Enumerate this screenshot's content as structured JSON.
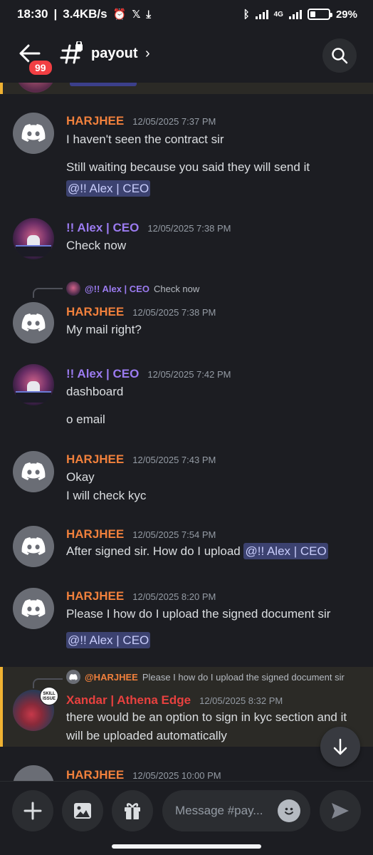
{
  "status": {
    "time": "18:30",
    "net_speed": "3.4KB/s",
    "network": "4G",
    "battery": "29%",
    "battery_level": 0.29
  },
  "header": {
    "unread_badge": "99",
    "channel": "payout",
    "chevron": "›"
  },
  "messages": [
    {
      "author": "HARJHEE",
      "time": "12/05/2025 7:37 PM",
      "lines": [
        "I haven't seen the contract sir",
        "Still waiting because you said they will send it"
      ],
      "mention": "@!! Alex | CEO"
    },
    {
      "author": "!! Alex | CEO",
      "time": "12/05/2025 7:38 PM",
      "lines": [
        "Check now"
      ]
    },
    {
      "author": "HARJHEE",
      "time": "12/05/2025 7:38 PM",
      "lines": [
        "My mail right?"
      ],
      "reply": {
        "author": "@!! Alex | CEO",
        "text": "Check now"
      }
    },
    {
      "author": "!! Alex | CEO",
      "time": "12/05/2025 7:42 PM",
      "lines": [
        "dashboard",
        "o email"
      ]
    },
    {
      "author": "HARJHEE",
      "time": "12/05/2025 7:43 PM",
      "lines": [
        "Okay",
        "I will check kyc"
      ]
    },
    {
      "author": "HARJHEE",
      "time": "12/05/2025 7:54 PM",
      "lines": [
        "After signed sir. How do I upload"
      ],
      "mention": "@!! Alex | CEO"
    },
    {
      "author": "HARJHEE",
      "time": "12/05/2025 8:20 PM",
      "lines": [
        "Please I how do I upload the signed document sir"
      ],
      "mention": "@!! Alex | CEO"
    },
    {
      "author": "Xandar | Athena Edge",
      "time": "12/05/2025 8:32 PM",
      "lines": [
        "there would be an option to sign in kyc section and it",
        "will be uploaded automatically"
      ],
      "reply": {
        "author": "@HARJHEE",
        "text": "Please I how do I upload the signed document sir"
      },
      "avatar_badge": "SKILL ISSUE"
    },
    {
      "author": "HARJHEE",
      "time": "12/05/2025 10:00 PM",
      "lines": []
    }
  ],
  "composer": {
    "placeholder": "Message #pay..."
  },
  "colors": {
    "background": "#1c1d22",
    "harjhee": "#f0803c",
    "alex": "#9b7bf0",
    "xandar": "#e8413f",
    "mention_bg": "#3c4270",
    "highlight_border": "#f0b232"
  },
  "icons": [
    "back-arrow-icon",
    "channel-hash-lock-icon",
    "search-icon",
    "arrow-down-icon",
    "plus-icon",
    "image-icon",
    "gift-icon",
    "emoji-icon",
    "send-icon"
  ]
}
